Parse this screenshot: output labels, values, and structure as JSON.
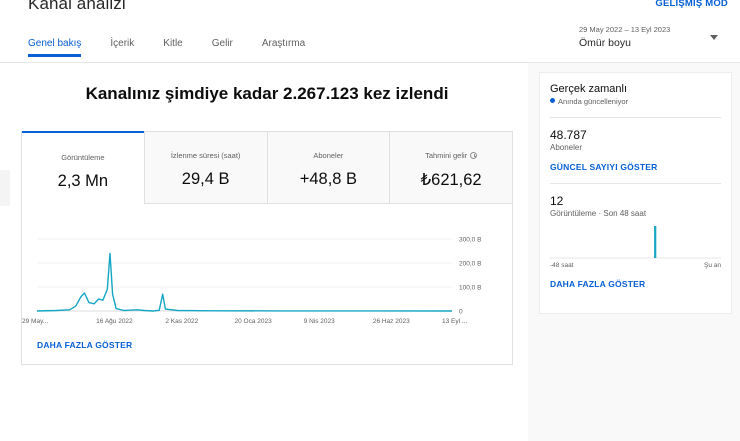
{
  "header": {
    "title": "Kanal analizi",
    "advanced_mode": "GELİŞMİŞ MOD"
  },
  "tabs": [
    {
      "label": "Genel bakış",
      "active": true
    },
    {
      "label": "İçerik",
      "active": false
    },
    {
      "label": "Kitle",
      "active": false
    },
    {
      "label": "Gelir",
      "active": false
    },
    {
      "label": "Araştırma",
      "active": false
    }
  ],
  "date_picker": {
    "range": "29 May 2022 – 13 Eyl 2023",
    "value": "Ömür boyu"
  },
  "main": {
    "heading": "Kanalınız şimdiye kadar 2.267.123 kez izlendi",
    "metrics": [
      {
        "label": "Görüntüleme",
        "value": "2,3 Mn",
        "active": true
      },
      {
        "label": "İzlenme süresi (saat)",
        "value": "29,4 B",
        "active": false
      },
      {
        "label": "Aboneler",
        "value": "+48,8 B",
        "active": false
      },
      {
        "label": "Tahmini gelir",
        "value": "₺621,62",
        "active": false
      }
    ],
    "more_link": "DAHA FAZLA GÖSTER"
  },
  "chart_data": {
    "type": "line",
    "series_color": "#14a6c4",
    "y_ticks": [
      "300,0 B",
      "200,0 B",
      "100,0 B",
      "0"
    ],
    "y_tick_values": [
      300000,
      200000,
      100000,
      0
    ],
    "ylim": [
      0,
      300000
    ],
    "x_tick_labels": [
      "29 May...",
      "16 Ağu 2022",
      "2 Kas 2022",
      "20 Oca 2023",
      "9 Nis 2023",
      "26 Haz 2023",
      "13 Eyl ..."
    ],
    "x_start": "2022-05-29",
    "x_end": "2023-09-13",
    "points": [
      [
        "2022-05-29",
        0
      ],
      [
        "2022-06-20",
        2000
      ],
      [
        "2022-07-05",
        5000
      ],
      [
        "2022-07-12",
        20000
      ],
      [
        "2022-07-18",
        60000
      ],
      [
        "2022-07-22",
        75000
      ],
      [
        "2022-07-27",
        35000
      ],
      [
        "2022-08-02",
        30000
      ],
      [
        "2022-08-07",
        50000
      ],
      [
        "2022-08-12",
        45000
      ],
      [
        "2022-08-17",
        90000
      ],
      [
        "2022-08-20",
        240000
      ],
      [
        "2022-08-23",
        70000
      ],
      [
        "2022-08-27",
        10000
      ],
      [
        "2022-09-05",
        2000
      ],
      [
        "2022-09-20",
        5000
      ],
      [
        "2022-09-28",
        2000
      ],
      [
        "2022-10-08",
        0
      ],
      [
        "2022-10-15",
        3000
      ],
      [
        "2022-10-19",
        70000
      ],
      [
        "2022-10-22",
        8000
      ],
      [
        "2022-11-05",
        2000
      ],
      [
        "2022-12-15",
        1000
      ],
      [
        "2023-03-01",
        500
      ],
      [
        "2023-06-01",
        300
      ],
      [
        "2023-09-13",
        200
      ]
    ],
    "grid": true
  },
  "realtime": {
    "title": "Gerçek zamanlı",
    "subtitle": "Anında güncelleniyor",
    "subscribers_value": "48.787",
    "subscribers_label": "Aboneler",
    "subscribers_link": "GÜNCEL SAYIYI GÖSTER",
    "views_value": "12",
    "views_label": "Görüntüleme · Son 48 saat",
    "axis_left": "-48 saat",
    "axis_right": "Şu an",
    "more_link": "DAHA FAZLA GÖSTER",
    "bars": [
      0,
      0,
      0,
      0,
      0,
      0,
      0,
      0,
      0,
      0,
      0,
      0,
      0,
      0,
      0,
      0,
      0,
      0,
      0,
      0,
      0,
      0,
      0,
      0,
      0,
      0,
      0,
      0,
      0,
      12,
      0,
      0,
      0,
      0,
      0,
      0,
      0,
      0,
      0,
      0,
      0,
      0,
      0,
      0,
      0,
      0,
      0,
      0
    ]
  },
  "colors": {
    "accent": "#065fd4",
    "chart_line": "#14a6c4"
  }
}
